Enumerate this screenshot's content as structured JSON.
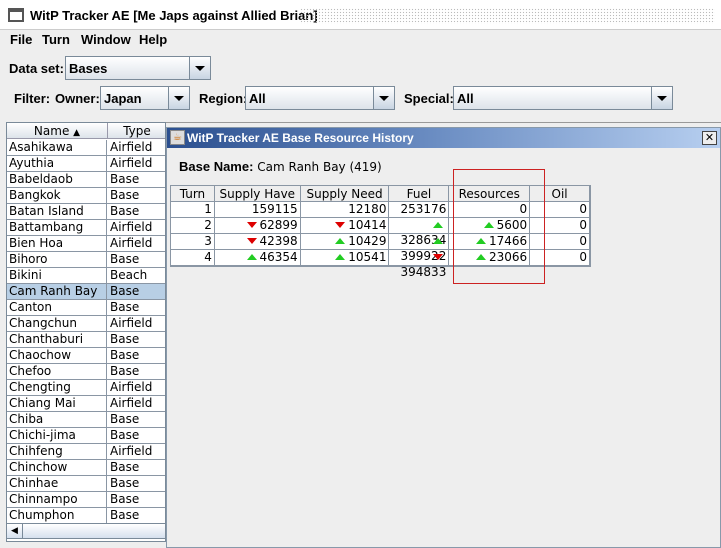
{
  "window": {
    "title": "WitP Tracker AE [Me Japs against Allied Brian]"
  },
  "menu": [
    {
      "label": "File"
    },
    {
      "label": "Turn"
    },
    {
      "label": "Window"
    },
    {
      "label": "Help"
    }
  ],
  "dataset": {
    "label": "Data set:",
    "value": "Bases"
  },
  "filter": {
    "label": "Filter:",
    "owner_label": "Owner:",
    "owner": "Japan",
    "region_label": "Region:",
    "region": "All",
    "special_label": "Special:",
    "special": "All"
  },
  "bases_table": {
    "columns": [
      "Name",
      "Type"
    ],
    "selected": "Cam Ranh Bay",
    "rows": [
      [
        "Asahikawa",
        "Airfield"
      ],
      [
        "Ayuthia",
        "Airfield"
      ],
      [
        "Babeldaob",
        "Base"
      ],
      [
        "Bangkok",
        "Base"
      ],
      [
        "Batan Island",
        "Base"
      ],
      [
        "Battambang",
        "Airfield"
      ],
      [
        "Bien Hoa",
        "Airfield"
      ],
      [
        "Bihoro",
        "Base"
      ],
      [
        "Bikini",
        "Beach"
      ],
      [
        "Cam Ranh Bay",
        "Base"
      ],
      [
        "Canton",
        "Base"
      ],
      [
        "Changchun",
        "Airfield"
      ],
      [
        "Chanthaburi",
        "Base"
      ],
      [
        "Chaochow",
        "Base"
      ],
      [
        "Chefoo",
        "Base"
      ],
      [
        "Chengting",
        "Airfield"
      ],
      [
        "Chiang Mai",
        "Airfield"
      ],
      [
        "Chiba",
        "Base"
      ],
      [
        "Chichi-jima",
        "Base"
      ],
      [
        "Chihfeng",
        "Airfield"
      ],
      [
        "Chinchow",
        "Base"
      ],
      [
        "Chinhae",
        "Base"
      ],
      [
        "Chinnampo",
        "Base"
      ],
      [
        "Chumphon",
        "Base"
      ]
    ]
  },
  "history": {
    "title": "WitP Tracker AE Base Resource History",
    "base_label": "Base Name:",
    "base_value": "Cam Ranh Bay (419)",
    "columns": [
      "Turn",
      "Supply Have",
      "Supply Need",
      "Fuel",
      "Resources",
      "Oil"
    ],
    "highlighted_column": "Resources",
    "rows": [
      [
        {
          "v": "1"
        },
        {
          "v": "159115"
        },
        {
          "v": "12180"
        },
        {
          "v": "253176"
        },
        {
          "v": "0"
        },
        {
          "v": "0"
        }
      ],
      [
        {
          "v": "2"
        },
        {
          "v": "62899",
          "t": "down"
        },
        {
          "v": "10414",
          "t": "down"
        },
        {
          "v": "328634",
          "t": "up"
        },
        {
          "v": "5600",
          "t": "up"
        },
        {
          "v": "0"
        }
      ],
      [
        {
          "v": "3"
        },
        {
          "v": "42398",
          "t": "down"
        },
        {
          "v": "10429",
          "t": "up"
        },
        {
          "v": "399922",
          "t": "up"
        },
        {
          "v": "17466",
          "t": "up"
        },
        {
          "v": "0"
        }
      ],
      [
        {
          "v": "4"
        },
        {
          "v": "46354",
          "t": "up"
        },
        {
          "v": "10541",
          "t": "up"
        },
        {
          "v": "394833",
          "t": "down"
        },
        {
          "v": "23066",
          "t": "up"
        },
        {
          "v": "0"
        }
      ]
    ]
  },
  "colors": {
    "up": "#22cc22",
    "down": "#dd0000",
    "highlight": "#cc2222",
    "title_bar": "#2b4f8f"
  }
}
